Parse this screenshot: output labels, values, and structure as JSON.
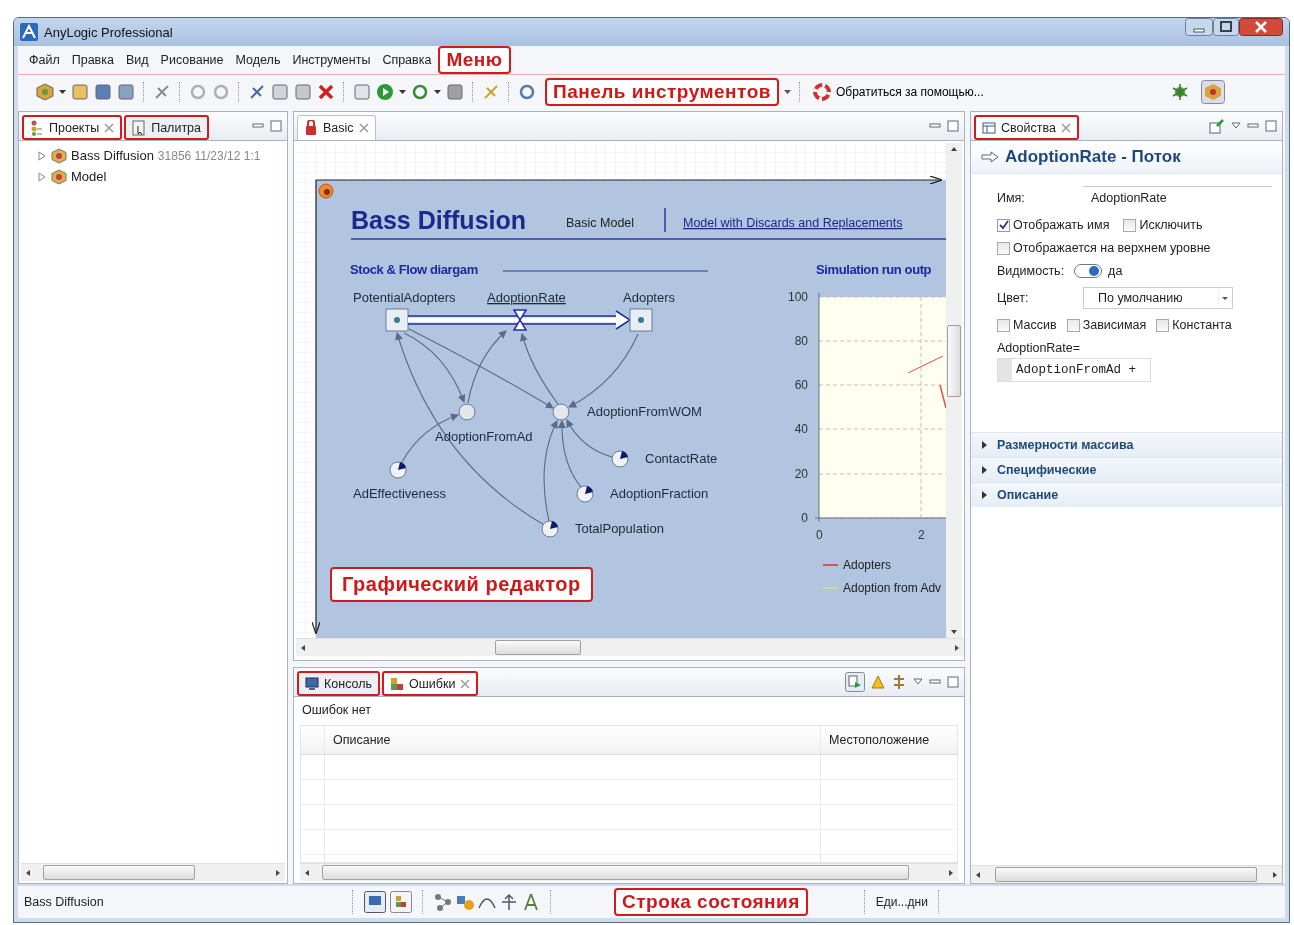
{
  "window": {
    "title": "AnyLogic Professional"
  },
  "menu": {
    "items": [
      "Файл",
      "Правка",
      "Вид",
      "Рисование",
      "Модель",
      "Инструменты",
      "Справка"
    ],
    "callout": "Меню"
  },
  "toolbar": {
    "callout": "Панель инструментов",
    "help_button": "Обратиться за помощью..."
  },
  "left_panel": {
    "tabs": [
      {
        "label": "Проекты",
        "selected": true,
        "highlighted": true
      },
      {
        "label": "Палитра",
        "selected": false,
        "highlighted": true
      }
    ],
    "tree": [
      {
        "label": "Bass Diffusion",
        "detail": "31856 11/23/12 1:1",
        "expanded": false
      },
      {
        "label": "Model",
        "expanded": false
      }
    ]
  },
  "editor": {
    "tab": {
      "label": "Basic",
      "selected": true,
      "highlighted": false
    },
    "title": "Bass Diffusion",
    "links": [
      {
        "label": "Basic Model",
        "selected": true
      },
      {
        "label": "Model with Discards and Replacements",
        "selected": false
      }
    ],
    "diagram": {
      "title": "Stock & Flow diargam",
      "nodes": [
        {
          "kind": "stock",
          "label": "PotentialAdopters"
        },
        {
          "kind": "flow",
          "label": "AdoptionRate"
        },
        {
          "kind": "stock",
          "label": "Adopters"
        },
        {
          "kind": "variable",
          "label": "AdoptionFromAd"
        },
        {
          "kind": "variable",
          "label": "AdoptionFromWOM"
        },
        {
          "kind": "parameter",
          "label": "AdEffectiveness"
        },
        {
          "kind": "parameter",
          "label": "ContactRate"
        },
        {
          "kind": "parameter",
          "label": "AdoptionFraction"
        },
        {
          "kind": "parameter",
          "label": "TotalPopulation"
        }
      ]
    },
    "chart": {
      "title": "Simulation run outp",
      "yticks": [
        "100",
        "80",
        "60",
        "40",
        "20",
        "0"
      ],
      "xticks": [
        "0",
        "2"
      ],
      "legend": [
        {
          "name": "Adopters",
          "color": "#e05050"
        },
        {
          "name": "Adoption from Adv",
          "color": "#c8dc98"
        }
      ]
    },
    "callout": "Графический редактор"
  },
  "properties": {
    "tab": {
      "label": "Свойства",
      "selected": true,
      "highlighted": true
    },
    "heading": "AdoptionRate - Поток",
    "name_label": "Имя:",
    "name_value": "AdoptionRate",
    "display_options": [
      {
        "label": "Отображать имя",
        "checked": true
      },
      {
        "label": "Исключить",
        "checked": false
      }
    ],
    "top_level_option": {
      "label": "Отображается на верхнем уровне",
      "checked": false
    },
    "visibility": {
      "label": "Видимость:",
      "on": true,
      "value": "да"
    },
    "color": {
      "label": "Цвет:",
      "value": "По умолчанию"
    },
    "type_options": [
      {
        "label": "Массив",
        "checked": false
      },
      {
        "label": "Зависимая",
        "checked": false
      },
      {
        "label": "Константа",
        "checked": false
      }
    ],
    "formula_label": "AdoptionRate=",
    "formula": "AdoptionFromAd +",
    "sections": [
      {
        "label": "Размерности массива",
        "expanded": false
      },
      {
        "label": "Специфические",
        "expanded": false
      },
      {
        "label": "Описание",
        "expanded": false
      }
    ]
  },
  "bottom_panel": {
    "tabs": [
      {
        "label": "Консоль",
        "selected": false,
        "highlighted": true
      },
      {
        "label": "Ошибки",
        "selected": true,
        "highlighted": true
      }
    ],
    "message": "Ошибок нет",
    "columns": [
      "Описание",
      "Местоположение"
    ]
  },
  "status_bar": {
    "text": "Bass Diffusion",
    "callout": "Строка состояния",
    "units": "Еди...дни"
  }
}
